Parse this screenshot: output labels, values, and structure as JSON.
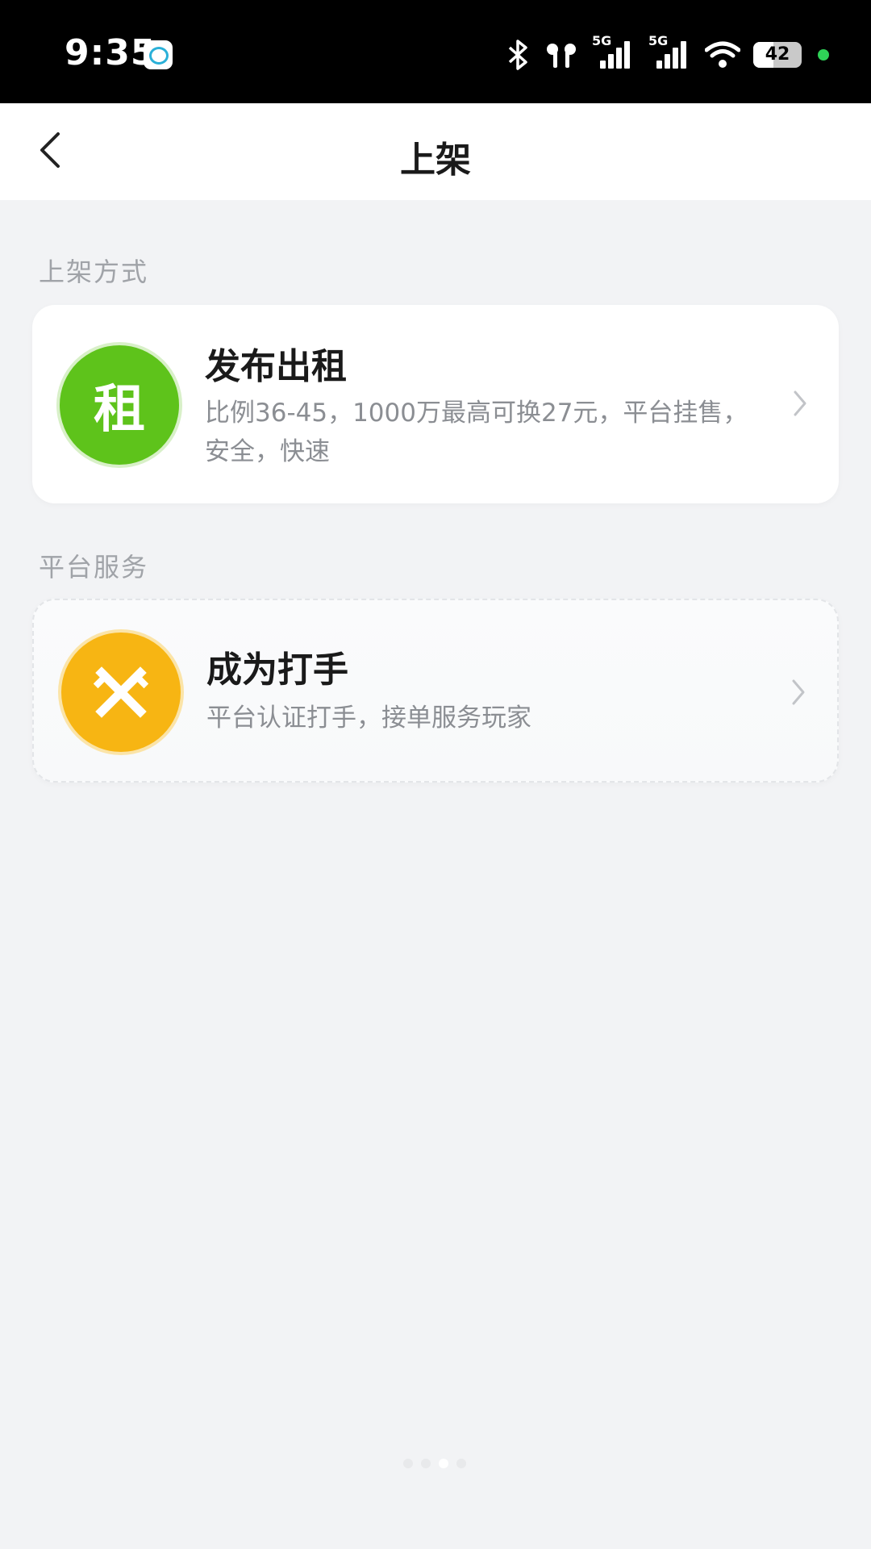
{
  "status_bar": {
    "time": "9:35",
    "app_icon": "message-app-icon",
    "icons": [
      "bluetooth-icon",
      "earbuds-icon",
      "signal-5g-icon",
      "signal-5g-icon",
      "wifi-icon"
    ],
    "signal_tag_1": "5G",
    "signal_tag_2": "5G",
    "battery": "42"
  },
  "header": {
    "title": "上架",
    "back_icon": "chevron-left-icon"
  },
  "sections": [
    {
      "label": "上架方式",
      "card": {
        "icon_char": "租",
        "icon_color": "#5ec31b",
        "title": "发布出租",
        "desc_line1": "比例36-45，1000万最高可换27元，平台挂售，",
        "desc_line2": "安全，快速"
      }
    },
    {
      "label": "平台服务",
      "card": {
        "icon": "crossed-swords-icon",
        "icon_color": "#f7b513",
        "title": "成为打手",
        "desc_line1": "平台认证打手，接单服务玩家"
      }
    }
  ]
}
